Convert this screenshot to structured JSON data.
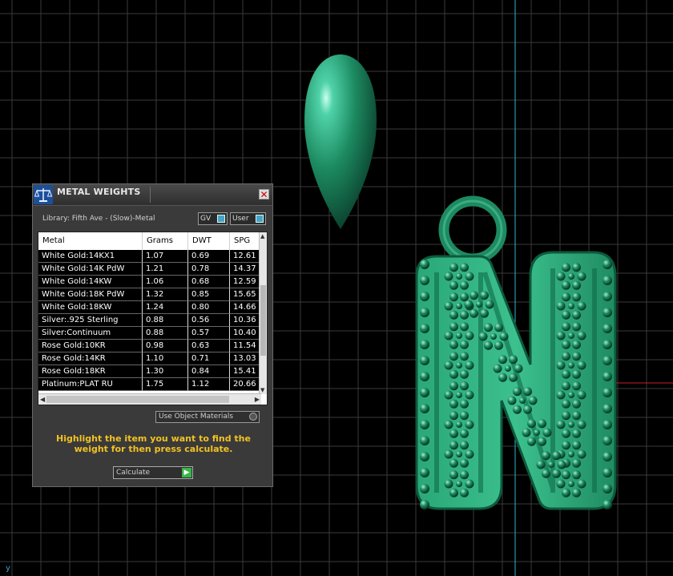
{
  "window": {
    "title": "METAL WEIGHTS",
    "close_glyph": "✕"
  },
  "library": {
    "label": "Library: Fifth Ave - (Slow)-Metal",
    "gv_label": "GV",
    "user_label": "User"
  },
  "table": {
    "columns": [
      "Metal",
      "Grams",
      "DWT",
      "SPG"
    ],
    "rows": [
      [
        "White Gold:14KX1",
        "1.07",
        "0.69",
        "12.61"
      ],
      [
        "White Gold:14K PdW",
        "1.21",
        "0.78",
        "14.37"
      ],
      [
        "White Gold:14KW",
        "1.06",
        "0.68",
        "12.59"
      ],
      [
        "White Gold:18K PdW",
        "1.32",
        "0.85",
        "15.65"
      ],
      [
        "White Gold:18KW",
        "1.24",
        "0.80",
        "14.66"
      ],
      [
        "Silver:.925 Sterling",
        "0.88",
        "0.56",
        "10.36"
      ],
      [
        "Silver:Continuum",
        "0.88",
        "0.57",
        "10.40"
      ],
      [
        "Rose Gold:10KR",
        "0.98",
        "0.63",
        "11.54"
      ],
      [
        "Rose Gold:14KR",
        "1.10",
        "0.71",
        "13.03"
      ],
      [
        "Rose Gold:18KR",
        "1.30",
        "0.84",
        "15.41"
      ],
      [
        "Platinum:PLAT RU",
        "1.75",
        "1.12",
        "20.66"
      ]
    ]
  },
  "use_object_materials_label": "Use Object Materials",
  "instructions": "Highlight the item you want to find the weight for then press calculate.",
  "calculate_label": "Calculate",
  "axis_label": "y",
  "colors": {
    "accent_yellow": "#f2c222",
    "grid": "#3c3c3c",
    "axis_cyan": "#2fb7c6",
    "axis_red": "#c81e1e",
    "model_green": "#1f8a64"
  }
}
